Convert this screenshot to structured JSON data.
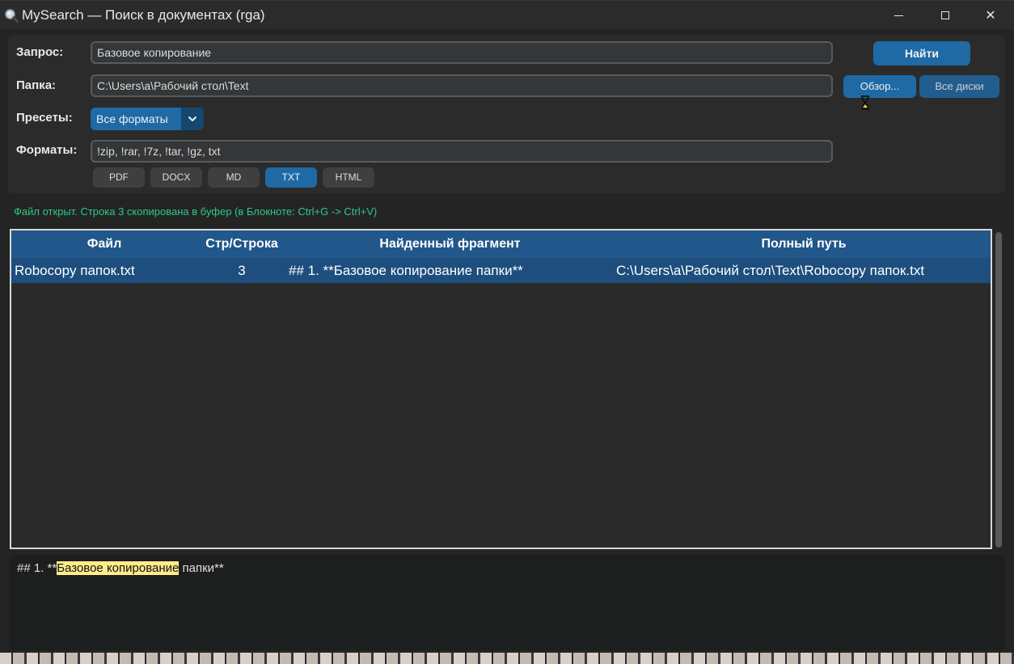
{
  "window": {
    "title": "MySearch — Поиск в документах (rga)",
    "controls": {
      "minimize": "minimize",
      "maximize": "maximize",
      "close": "✕"
    }
  },
  "form": {
    "query_label": "Запрос:",
    "query_value": "Базовое копирование",
    "folder_label": "Папка:",
    "folder_value": "C:\\Users\\a\\Рабочий стол\\Text",
    "presets_label": "Пресеты:",
    "preset_value": "Все форматы",
    "formats_label": "Форматы:",
    "formats_value": "!zip, !rar, !7z, !tar, !gz, txt",
    "find_button": "Найти",
    "browse_button": "Обзор...",
    "all_disks_button": "Все диски",
    "chips": [
      {
        "label": "PDF",
        "active": false
      },
      {
        "label": "DOCX",
        "active": false
      },
      {
        "label": "MD",
        "active": false
      },
      {
        "label": "TXT",
        "active": true
      },
      {
        "label": "HTML",
        "active": false
      }
    ]
  },
  "status": "Файл открыт. Строка 3 скопирована в буфер (в Блокноте: Ctrl+G -> Ctrl+V)",
  "results": {
    "columns": [
      "Файл",
      "Стр/Строка",
      "Найденный фрагмент",
      "Полный путь"
    ],
    "rows": [
      {
        "file": "Robocopy папок.txt",
        "line": "3",
        "fragment": "## 1. **Базовое копирование папки**",
        "path": "C:\\Users\\a\\Рабочий стол\\Text\\Robocopy папок.txt"
      }
    ]
  },
  "preview": {
    "before": "## 1. **",
    "highlight": "Базовое копирование",
    "after": " папки**"
  },
  "colors": {
    "accent": "#1f6aa5",
    "status_green": "#2cc985",
    "table_header": "#21578a",
    "selected_row": "#1d4e7e",
    "highlight": "#ffec8c"
  },
  "icons": {
    "app": "magnifier-icon",
    "preset_dropdown": "chevron-down-icon"
  }
}
